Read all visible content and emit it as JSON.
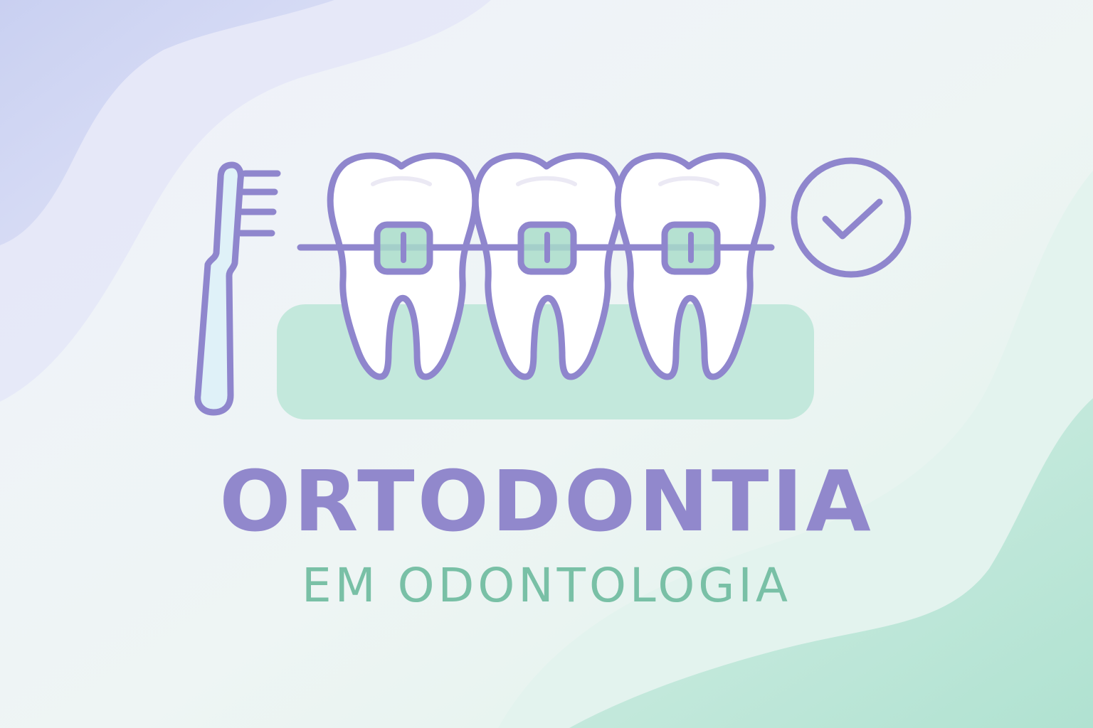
{
  "title": "ORTODONTIA",
  "subtitle": "EM ODONTOLOGIA",
  "icons": [
    "toothbrush-icon",
    "tooth-icon",
    "braces-bracket-icon",
    "check-circle-icon"
  ],
  "colors": {
    "primary": "#9188cc",
    "secondary": "#79c0a6",
    "outline": "#8f86cd",
    "gum": "#c3e8dc",
    "bracket": "#a8dcc9",
    "bg_left": "#cdd4f2",
    "bg_right": "#b3e4d4"
  }
}
